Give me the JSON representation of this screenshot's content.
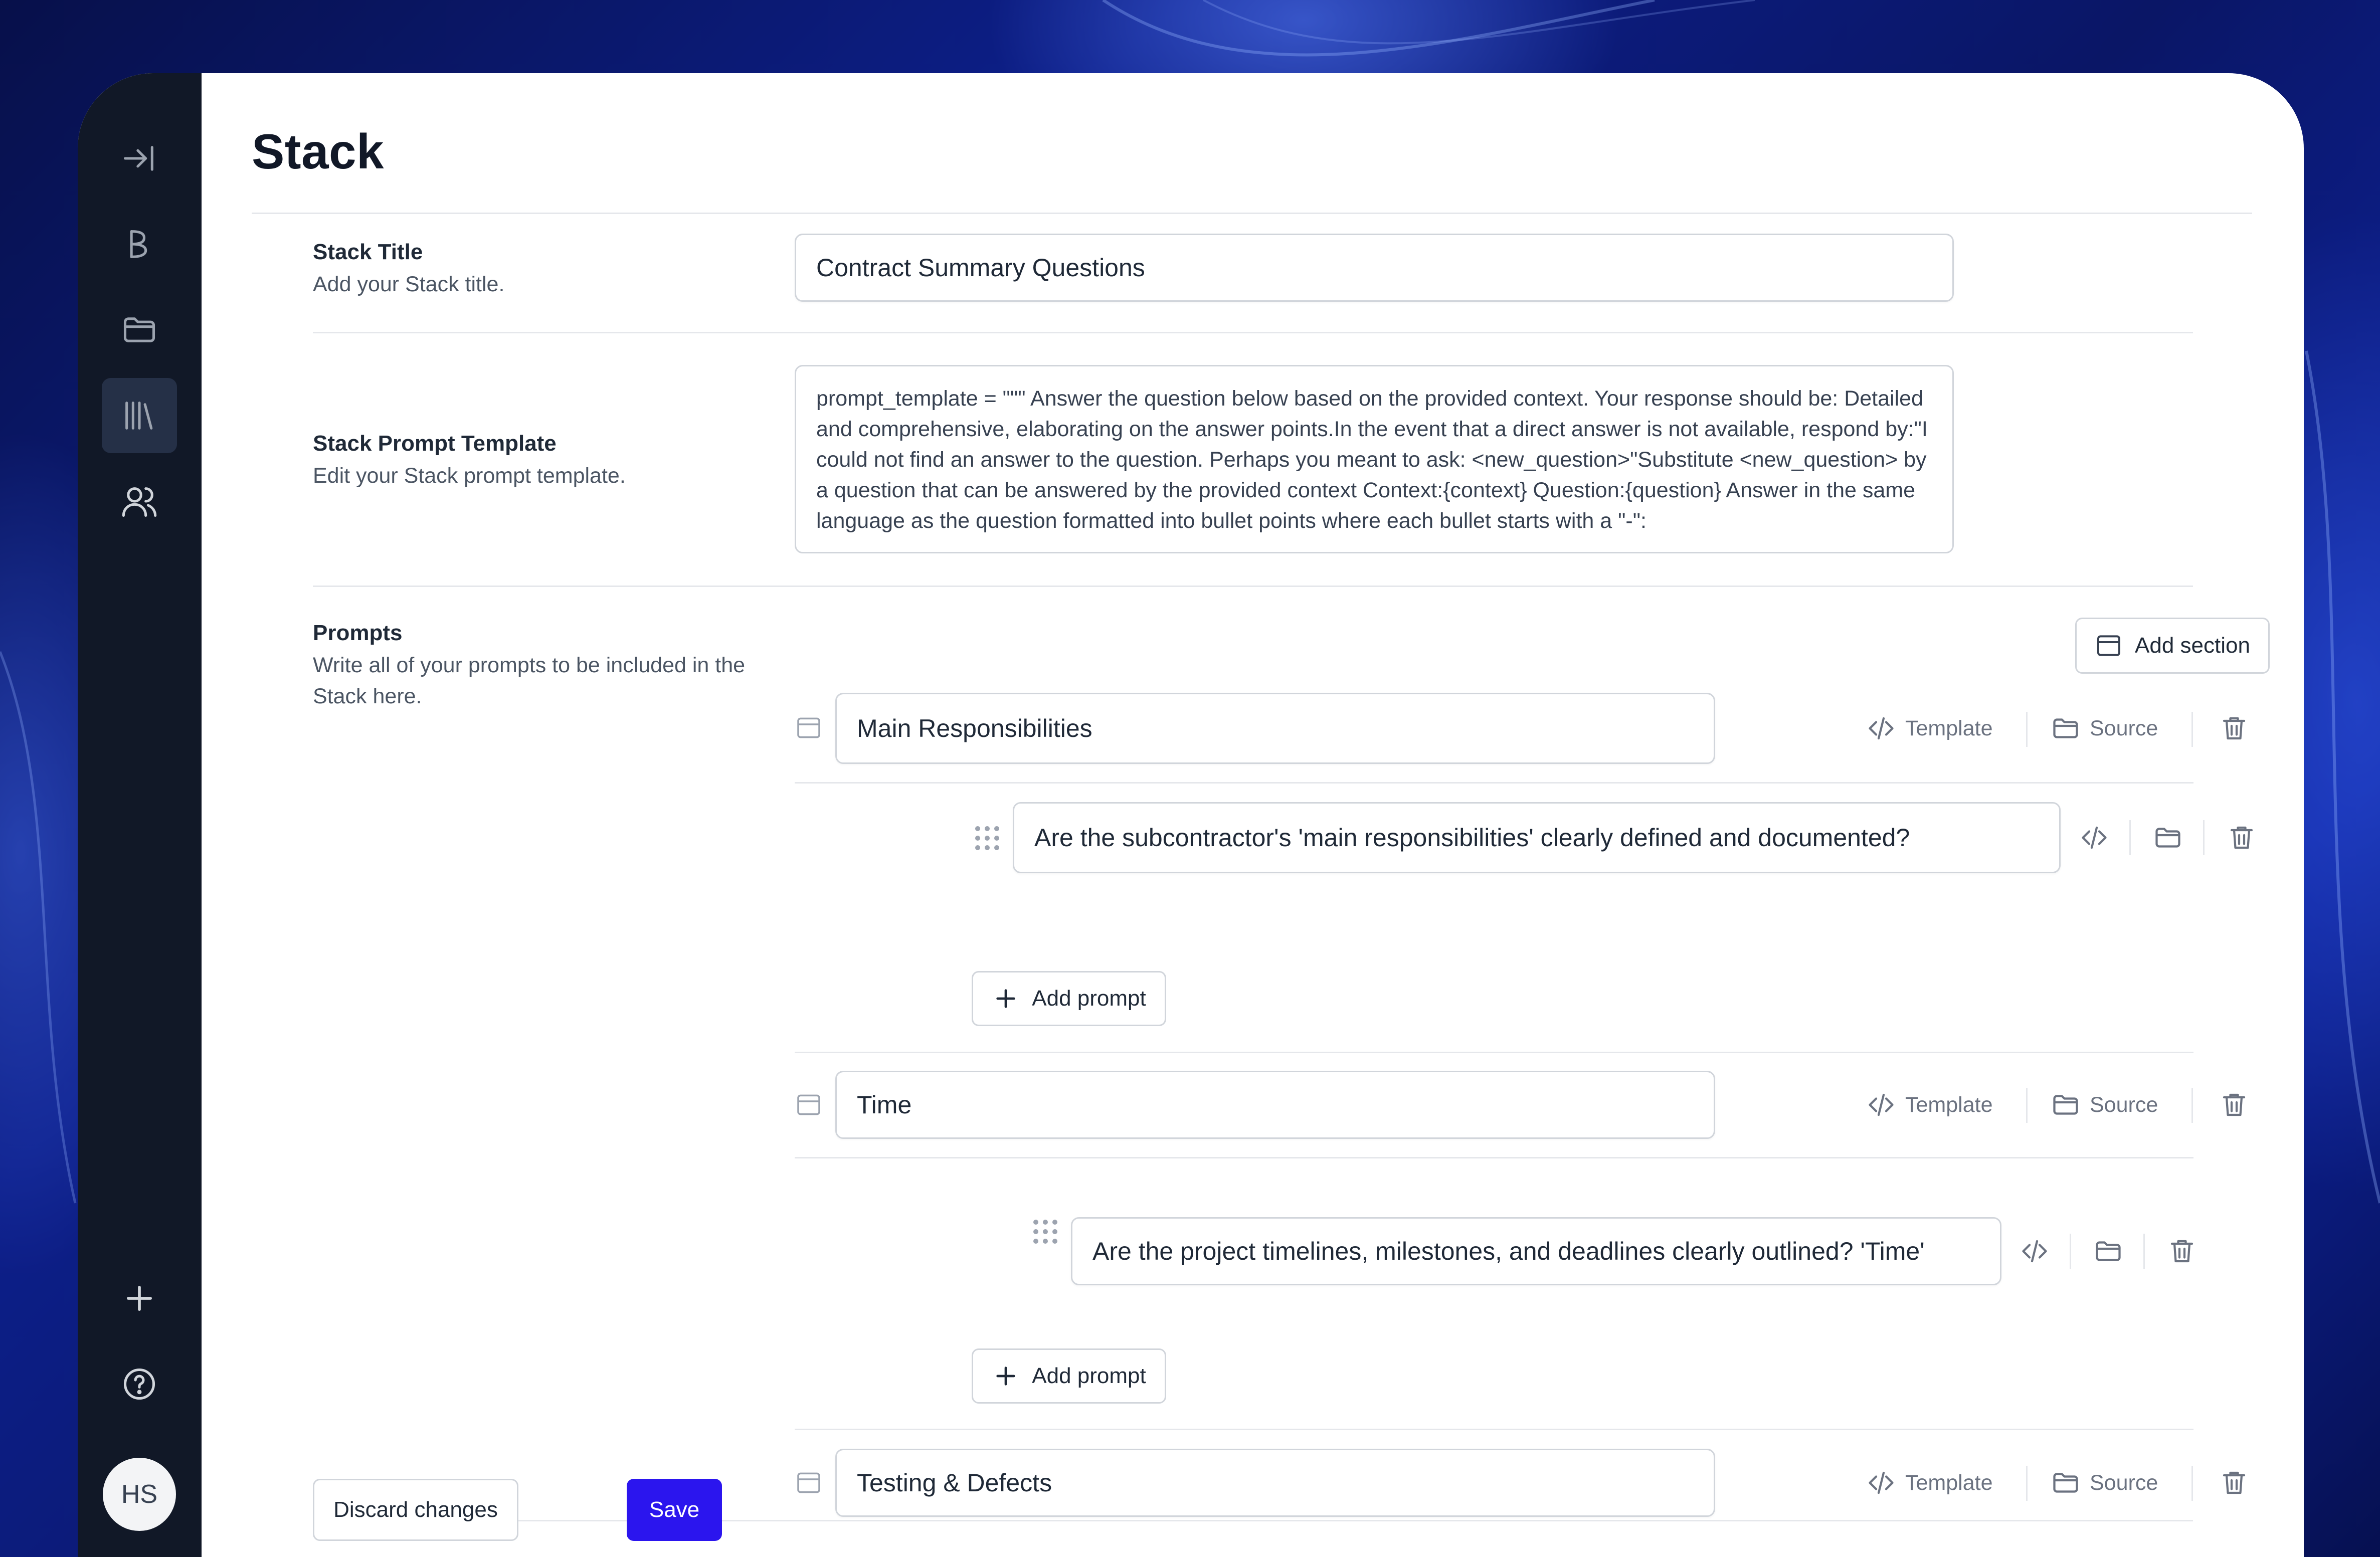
{
  "page": {
    "title": "Stack"
  },
  "sidebar": {
    "items": [
      {
        "name": "collapse",
        "icon": "arrow-to-right-icon"
      },
      {
        "name": "brand",
        "icon": "logo-icon"
      },
      {
        "name": "documents",
        "icon": "folder-icon"
      },
      {
        "name": "stacks",
        "icon": "library-icon",
        "active": true
      },
      {
        "name": "users",
        "icon": "users-icon"
      }
    ],
    "bottom": [
      {
        "name": "add",
        "icon": "plus-icon"
      },
      {
        "name": "help",
        "icon": "help-circle-icon"
      }
    ],
    "avatar_initials": "HS"
  },
  "stack_title": {
    "label": "Stack Title",
    "description": "Add your Stack title.",
    "value": "Contract Summary Questions"
  },
  "prompt_template": {
    "label": "Stack Prompt Template",
    "description": "Edit your Stack prompt template.",
    "value": "prompt_template = \"\"\" Answer the question below based on the provided context. Your response should be: Detailed and comprehensive, elaborating on the answer points.In the event that a direct answer is not available, respond by:\"I could not find an answer to the question. Perhaps you meant to ask: <new_question>\"Substitute <new_question> by a question that can be answered by the provided context Context:{context} Question:{question} Answer in the same language as the question formatted into bullet points where each bullet starts with a \"-\":"
  },
  "prompts": {
    "label": "Prompts",
    "description": "Write all of your prompts to be included in the Stack here.",
    "add_section_label": "Add section",
    "template_label": "Template",
    "source_label": "Source",
    "add_prompt_label": "Add prompt",
    "sections": [
      {
        "title": "Main Responsibilities",
        "prompts": [
          "Are the subcontractor's 'main responsibilities' clearly defined and documented?"
        ]
      },
      {
        "title": "Time",
        "prompts": [
          "Are the project timelines, milestones, and deadlines clearly outlined?  'Time'"
        ]
      },
      {
        "title": "Testing & Defects",
        "prompts": []
      }
    ]
  },
  "footer": {
    "discard_label": "Discard changes",
    "save_label": "Save"
  },
  "colors": {
    "primary": "#2b15ee",
    "sidebar": "#111827",
    "sidebar_active": "#253047"
  }
}
